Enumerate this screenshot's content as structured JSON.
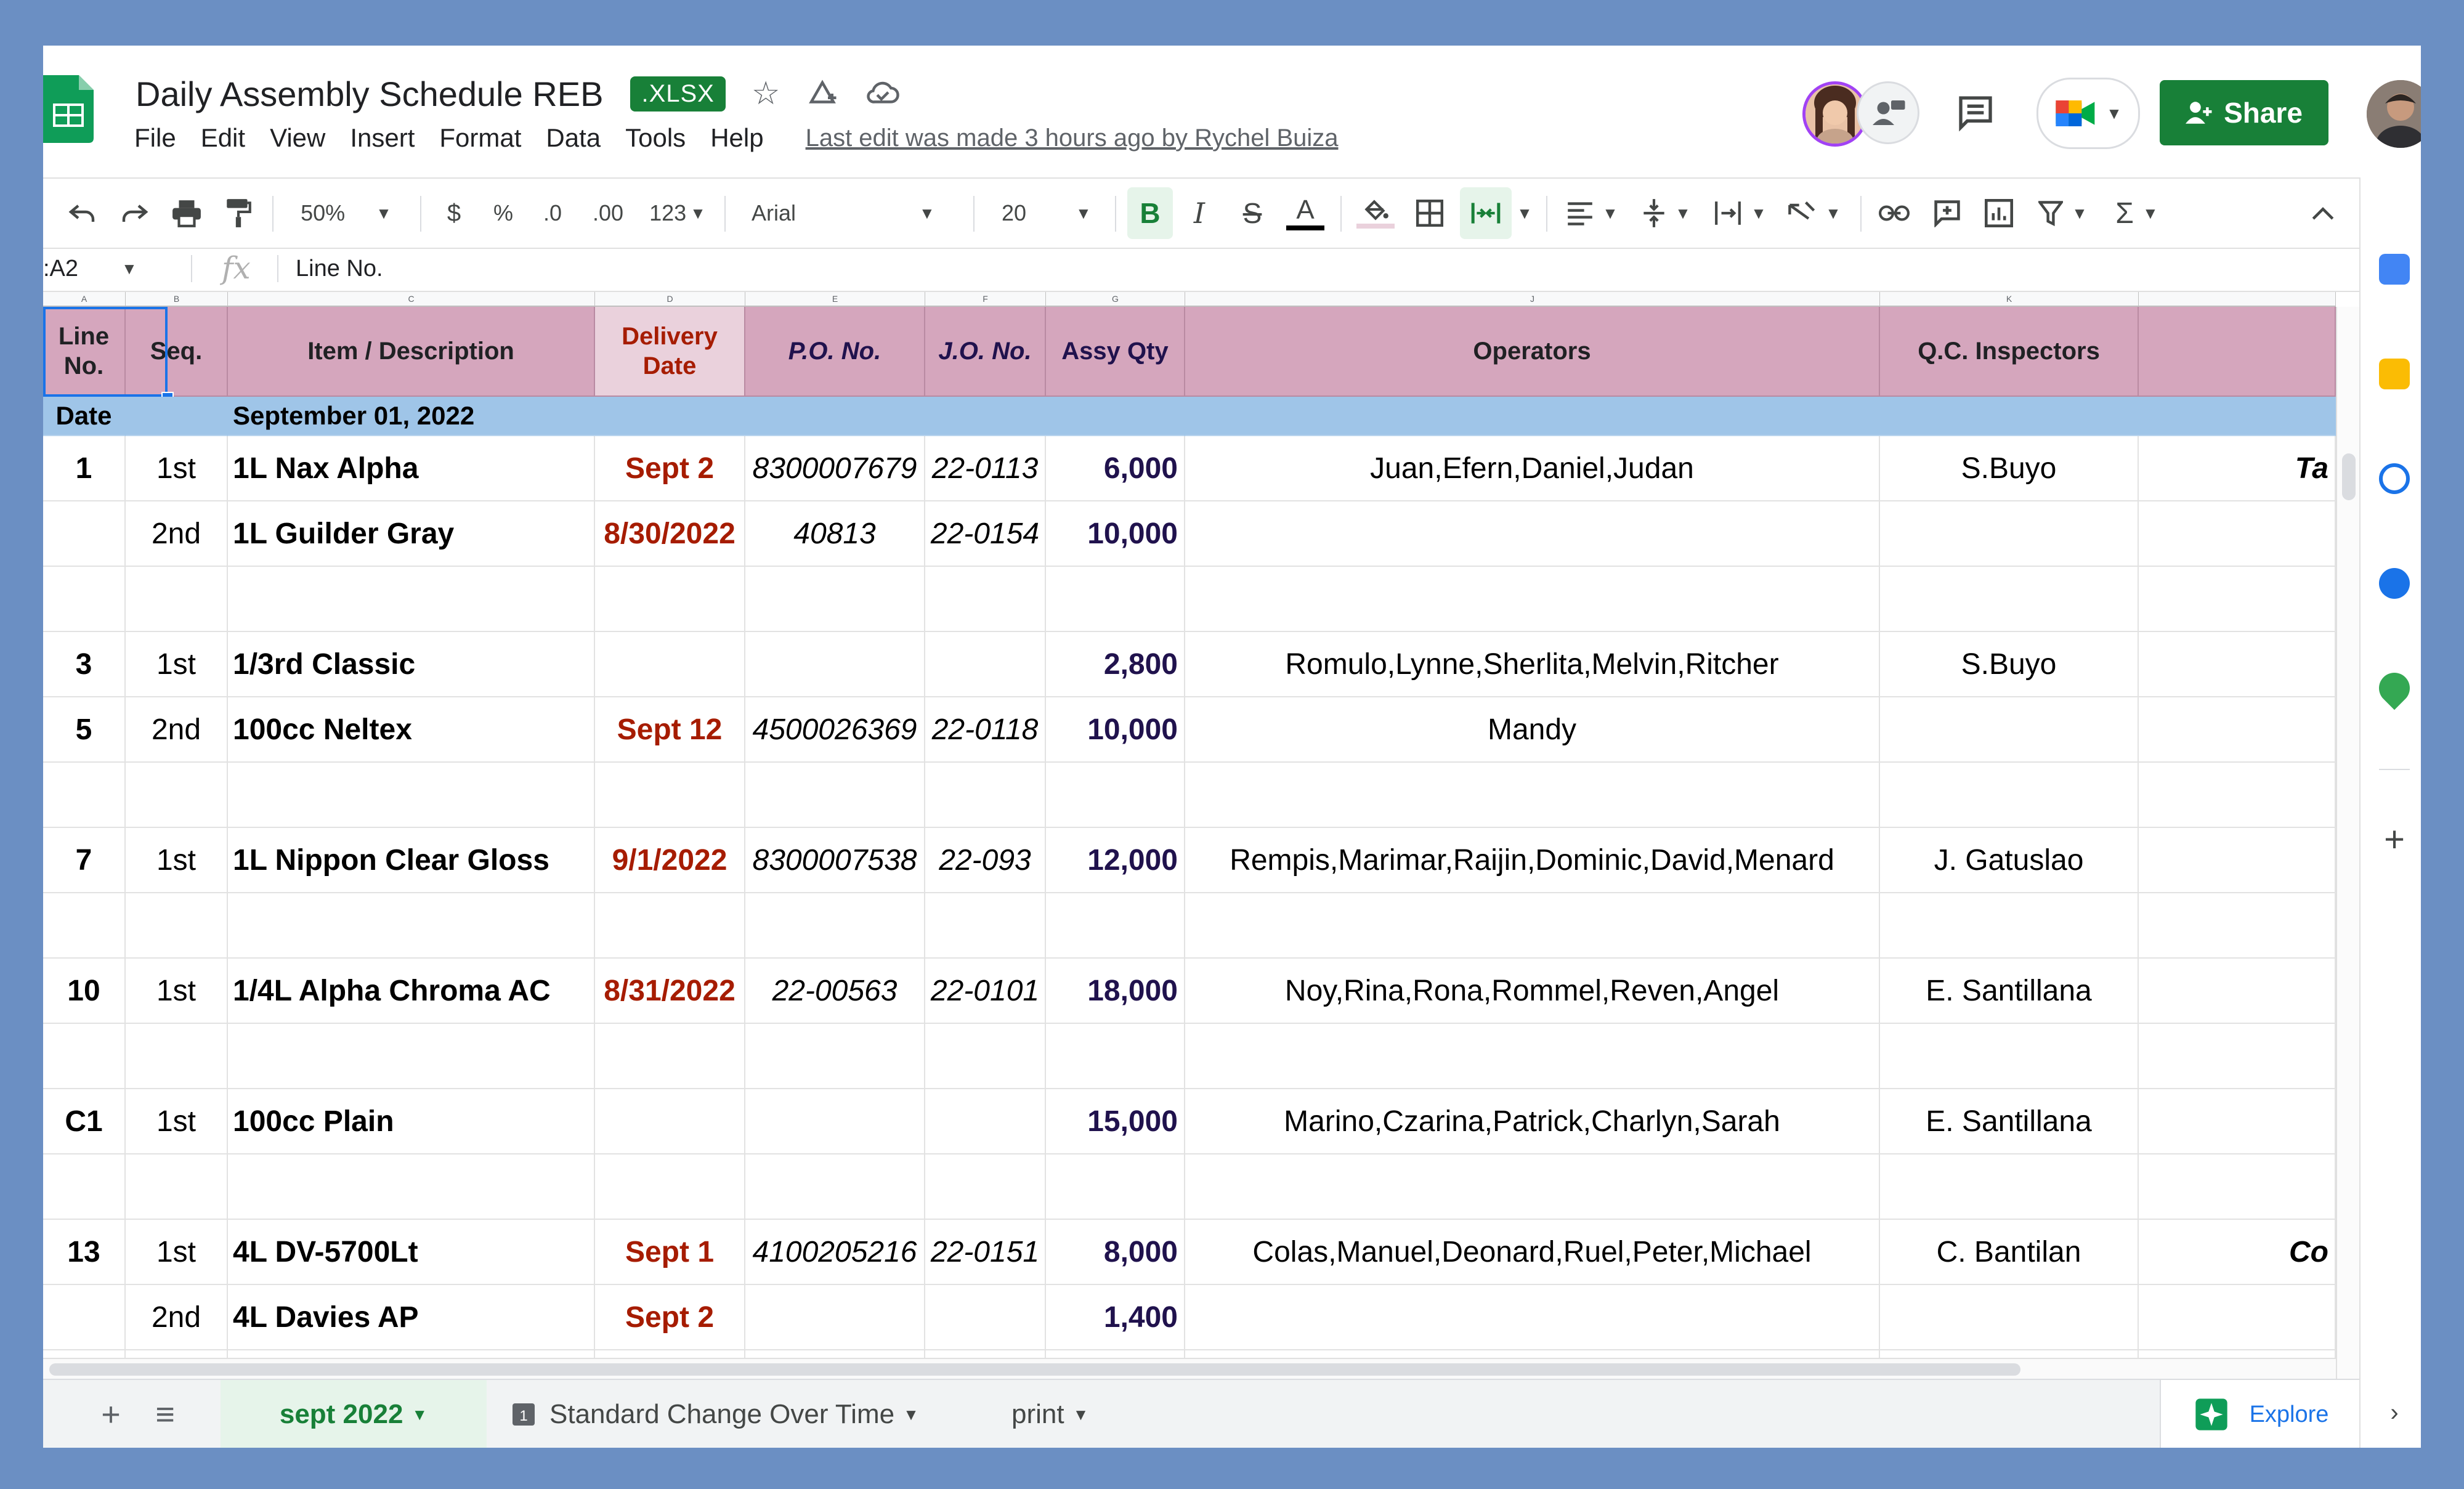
{
  "header": {
    "doc_title": "Daily Assembly Schedule  REB",
    "badge": ".XLSX",
    "last_edit": "Last edit was made 3 hours ago by Rychel Buiza",
    "share_label": "Share",
    "menu": [
      "File",
      "Edit",
      "View",
      "Insert",
      "Format",
      "Data",
      "Tools",
      "Help"
    ]
  },
  "toolbar": {
    "zoom": "50%",
    "currency": "$",
    "percent": "%",
    "dec_less": ".0",
    "dec_more": ".00",
    "more_formats": "123",
    "font": "Arial",
    "font_size": "20",
    "bold": "B",
    "italic": "I",
    "strike": "S",
    "text_color": "A",
    "sum": "Σ"
  },
  "formula_bar": {
    "name_box": ":A2",
    "fx": "fx",
    "content": "Line No."
  },
  "columns": {
    "letters": [
      "A",
      "B",
      "C",
      "D",
      "E",
      "F",
      "G",
      "J",
      "K"
    ]
  },
  "table": {
    "headers": {
      "line_no": "Line No.",
      "seq": "Seq.",
      "item": "Item / Description",
      "delivery": "Delivery Date",
      "po": "P.O. No.",
      "jo": "J.O. No.",
      "assy": "Assy Qty",
      "operators": "Operators",
      "qc": "Q.C. Inspectors"
    },
    "date_label": "Date",
    "date_value": "September 01, 2022",
    "rows": [
      {
        "line": "1",
        "seq": "1st",
        "item": "1L Nax Alpha",
        "delivery": "Sept 2",
        "po": "8300007679",
        "jo": "22-0113",
        "qty": "6,000",
        "operators": "Juan,Efern,Daniel,Judan",
        "qc": "S.Buyo",
        "extra": "Ta"
      },
      {
        "line": "",
        "seq": "2nd",
        "item": "1L Guilder Gray",
        "delivery": "8/30/2022",
        "po": "40813",
        "jo": "22-0154",
        "qty": "10,000",
        "operators": "",
        "qc": "",
        "extra": ""
      },
      {
        "line": "3",
        "seq": "1st",
        "item": "1/3rd Classic",
        "delivery": "",
        "po": "",
        "jo": "",
        "qty": "2,800",
        "operators": "Romulo,Lynne,Sherlita,Melvin,Ritcher",
        "qc": "S.Buyo",
        "extra": ""
      },
      {
        "line": "5",
        "seq": "2nd",
        "item": "100cc Neltex",
        "delivery": "Sept 12",
        "po": "4500026369",
        "jo": "22-0118",
        "qty": "10,000",
        "operators": "Mandy",
        "qc": "",
        "extra": ""
      },
      {
        "line": "7",
        "seq": "1st",
        "item": "1L Nippon Clear Gloss",
        "delivery": "9/1/2022",
        "po": "8300007538",
        "jo": "22-093",
        "qty": "12,000",
        "operators": "Rempis,Marimar,Raijin,Dominic,David,Menard",
        "qc": "J. Gatuslao",
        "extra": ""
      },
      {
        "line": "10",
        "seq": "1st",
        "item": "1/4L Alpha Chroma AC",
        "delivery": "8/31/2022",
        "po": "22-00563",
        "jo": "22-0101",
        "qty": "18,000",
        "operators": "Noy,Rina,Rona,Rommel,Reven,Angel",
        "qc": "E. Santillana",
        "extra": ""
      },
      {
        "line": "C1",
        "seq": "1st",
        "item": "100cc Plain",
        "delivery": "",
        "po": "",
        "jo": "",
        "qty": "15,000",
        "operators": "Marino,Czarina,Patrick,Charlyn,Sarah",
        "qc": "E. Santillana",
        "extra": ""
      },
      {
        "line": "13",
        "seq": "1st",
        "item": "4L DV-5700Lt",
        "delivery": "Sept 1",
        "po": "4100205216",
        "jo": "22-0151",
        "qty": "8,000",
        "operators": "Colas,Manuel,Deonard,Ruel,Peter,Michael",
        "qc": "C. Bantilan",
        "extra": "Co"
      },
      {
        "line": "",
        "seq": "2nd",
        "item": "4L Davies AP",
        "delivery": "Sept 2",
        "po": "",
        "jo": "",
        "qty": "1,400",
        "operators": "",
        "qc": "",
        "extra": ""
      }
    ]
  },
  "sheets": {
    "tabs": [
      "sept 2022",
      "Standard Change Over Time",
      "print"
    ],
    "explore": "Explore",
    "add": "+",
    "all_sheets": "≡"
  },
  "colors": {
    "header_pink": "#d5a6bd",
    "delivery_header": "#ead1dc",
    "date_band": "#9fc5e8",
    "delivery_red": "#a61c00",
    "qty_navy": "#20124d",
    "share_green": "#188038",
    "page_frame": "#6b8fc3"
  }
}
